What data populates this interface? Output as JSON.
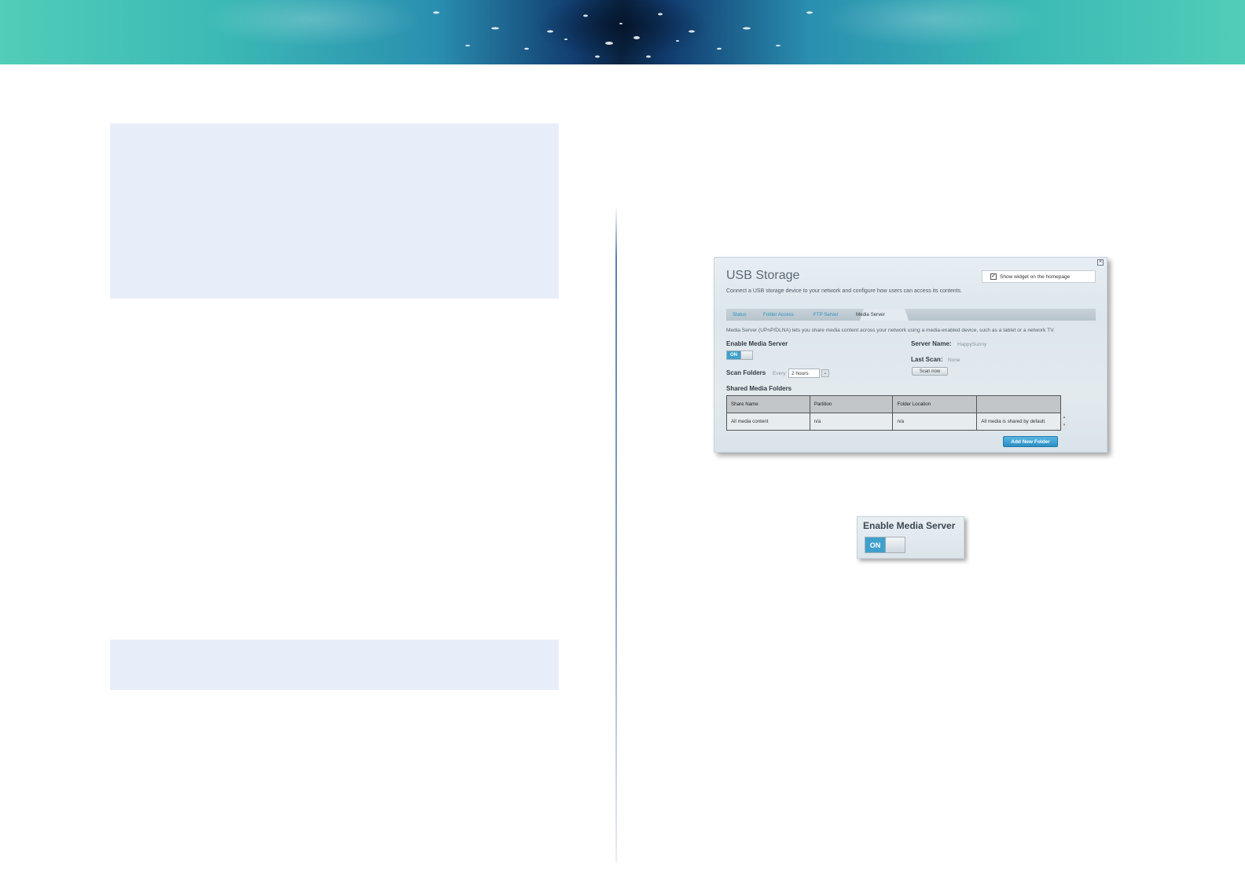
{
  "usb_storage": {
    "title": "USB Storage",
    "subtitle": "Connect a USB storage device to your network and configure how users can access its contents.",
    "show_widget_label": "Show widget on the homepage",
    "show_widget_checked": true,
    "tabs": [
      {
        "label": "Status"
      },
      {
        "label": "Folder Access"
      },
      {
        "label": "FTP Server"
      },
      {
        "label": "Media Server"
      }
    ],
    "active_tab": "Media Server",
    "description": "Media Server (UPnP/DLNA) lets you share media content across your network using a media-enabled device, such as a tablet or a network TV.",
    "enable_media_server_label": "Enable Media Server",
    "toggle_on_label": "ON",
    "scan_folders_label": "Scan Folders",
    "every_label": "Every",
    "scan_interval": "2 hours",
    "server_name_label": "Server Name:",
    "server_name_value": "HappySunny",
    "last_scan_label": "Last Scan:",
    "last_scan_value": "None",
    "scan_now_label": "Scan now",
    "shared_folders_label": "Shared Media Folders",
    "table": {
      "headers": [
        "Share Name",
        "Partition",
        "Folder Location",
        ""
      ],
      "rows": [
        [
          "All media content",
          "n/a",
          "n/a",
          "All media is shared by default."
        ]
      ]
    },
    "add_folder_label": "Add New Folder"
  },
  "zoom_callout": {
    "title": "Enable Media Server",
    "toggle_on_label": "ON"
  }
}
